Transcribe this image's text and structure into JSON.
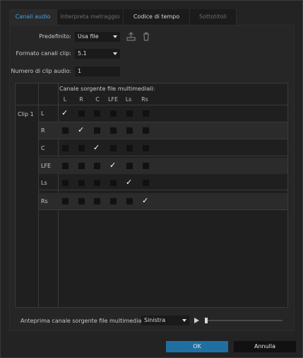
{
  "tabs": [
    {
      "label": "Canali audio"
    },
    {
      "label": "Interpreta metraggio"
    },
    {
      "label": "Codice di tempo"
    },
    {
      "label": "Sottotitoli"
    }
  ],
  "preset": {
    "label": "Predefinito:",
    "value": "Usa file"
  },
  "format": {
    "label": "Formato canali clip:",
    "value": "5.1"
  },
  "clip_count": {
    "label": "Numero di clip audio:",
    "value": "1"
  },
  "matrix": {
    "header": "Canale sorgente file multimediali:",
    "columns": [
      "L",
      "R",
      "C",
      "LFE",
      "Ls",
      "Rs"
    ],
    "clip_label": "Clip 1",
    "rows": [
      {
        "label": "L",
        "checked": 0
      },
      {
        "label": "R",
        "checked": 1
      },
      {
        "label": "C",
        "checked": 2
      },
      {
        "label": "LFE",
        "checked": 3
      },
      {
        "label": "Ls",
        "checked": 4
      },
      {
        "label": "Rs",
        "checked": 5
      }
    ],
    "check_glyph": "✓"
  },
  "preview": {
    "label": "Anteprima canale sorgente file multimediali:",
    "value": "Sinistra"
  },
  "buttons": {
    "ok": "OK",
    "cancel": "Annulla"
  },
  "colors": {
    "accent": "#48a1e6",
    "ok_button": "#1f6fa3",
    "panel": "#262626"
  }
}
